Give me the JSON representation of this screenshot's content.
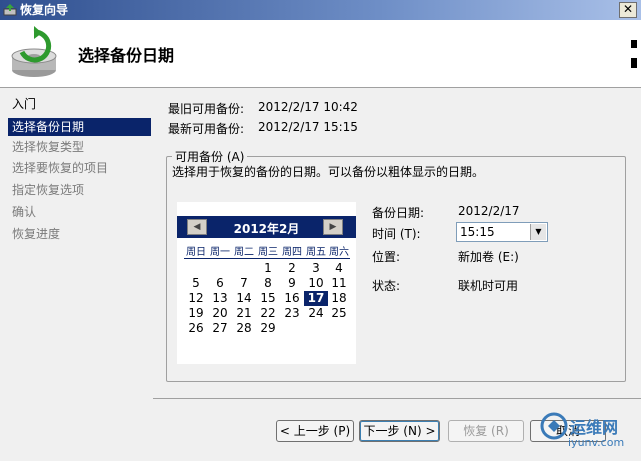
{
  "window": {
    "title": "恢复向导",
    "close_glyph": "✕"
  },
  "header": {
    "title": "选择备份日期",
    "icon": "backup-restore-icon"
  },
  "nav": {
    "items": [
      {
        "label": "入门",
        "state": "done"
      },
      {
        "label": "选择备份日期",
        "state": "active"
      },
      {
        "label": "选择恢复类型",
        "state": "pending"
      },
      {
        "label": "选择要恢复的项目",
        "state": "pending"
      },
      {
        "label": "指定恢复选项",
        "state": "pending"
      },
      {
        "label": "确认",
        "state": "pending"
      },
      {
        "label": "恢复进度",
        "state": "pending"
      }
    ]
  },
  "info": {
    "oldest_label": "最旧可用备份:",
    "oldest_value": "2012/2/17 10:42",
    "newest_label": "最新可用备份:",
    "newest_value": "2012/2/17 15:15"
  },
  "available": {
    "legend": "可用备份 (A)",
    "description": "选择用于恢复的备份的日期。可以备份以粗体显示的日期。"
  },
  "calendar": {
    "month_title": "2012年2月",
    "prev_glyph": "◀",
    "next_glyph": "▶",
    "weekdays": [
      "周日",
      "周一",
      "周二",
      "周三",
      "周四",
      "周五",
      "周六"
    ],
    "weeks": [
      [
        "",
        "",
        "",
        "1",
        "2",
        "3",
        "4"
      ],
      [
        "5",
        "6",
        "7",
        "8",
        "9",
        "10",
        "11"
      ],
      [
        "12",
        "13",
        "14",
        "15",
        "16",
        "17",
        "18"
      ],
      [
        "19",
        "20",
        "21",
        "22",
        "23",
        "24",
        "25"
      ],
      [
        "26",
        "27",
        "28",
        "29",
        "",
        "",
        ""
      ]
    ],
    "selected": "17"
  },
  "details": {
    "date_label": "备份日期:",
    "date_value": "2012/2/17",
    "time_label": "时间 (T):",
    "time_value": "15:15",
    "location_label": "位置:",
    "location_value": "新加卷  (E:)",
    "status_label": "状态:",
    "status_value": "联机时可用"
  },
  "buttons": {
    "back": "< 上一步 (P)",
    "next": "下一步 (N) >",
    "recover": "恢复 (R)",
    "cancel": "取消"
  },
  "watermark": {
    "cn": "运维网",
    "en": "iyunv.com"
  }
}
